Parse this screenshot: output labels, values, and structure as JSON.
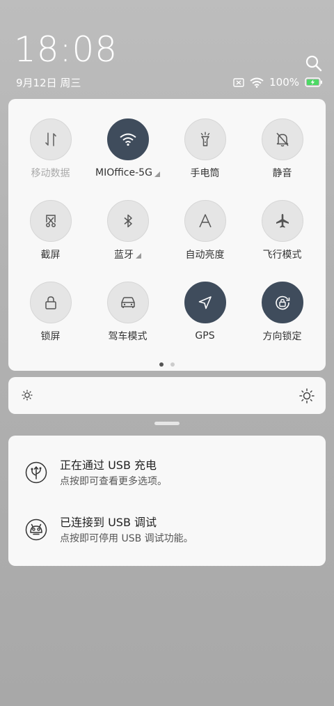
{
  "header": {
    "time": "18:08",
    "date": "9月12日 周三",
    "battery_percent": "100%",
    "icons": [
      "search-icon",
      "no-sim-icon",
      "wifi-icon",
      "battery-charging-icon"
    ]
  },
  "toggles": [
    {
      "label": "移动数据",
      "icon": "mobile-data-icon",
      "on": false,
      "dim": true,
      "expand": false
    },
    {
      "label": "MIOffice-5G",
      "icon": "wifi-icon",
      "on": true,
      "dim": false,
      "expand": true
    },
    {
      "label": "手电筒",
      "icon": "flashlight-icon",
      "on": false,
      "dim": false,
      "expand": false
    },
    {
      "label": "静音",
      "icon": "mute-bell-icon",
      "on": false,
      "dim": false,
      "expand": false
    },
    {
      "label": "截屏",
      "icon": "screenshot-icon",
      "on": false,
      "dim": false,
      "expand": false
    },
    {
      "label": "蓝牙",
      "icon": "bluetooth-icon",
      "on": false,
      "dim": false,
      "expand": true
    },
    {
      "label": "自动亮度",
      "icon": "auto-brightness-icon",
      "on": false,
      "dim": false,
      "expand": false
    },
    {
      "label": "飞行模式",
      "icon": "airplane-icon",
      "on": false,
      "dim": false,
      "expand": false
    },
    {
      "label": "锁屏",
      "icon": "lock-icon",
      "on": false,
      "dim": false,
      "expand": false
    },
    {
      "label": "驾车模式",
      "icon": "car-icon",
      "on": false,
      "dim": false,
      "expand": false
    },
    {
      "label": "GPS",
      "icon": "gps-icon",
      "on": true,
      "dim": false,
      "expand": false
    },
    {
      "label": "方向锁定",
      "icon": "rotation-lock-icon",
      "on": true,
      "dim": false,
      "expand": false
    }
  ],
  "pager": {
    "pages": 2,
    "active": 0
  },
  "brightness": {
    "icons": [
      "brightness-low-icon",
      "brightness-high-icon"
    ]
  },
  "notifications": [
    {
      "title": "正在通过 USB 充电",
      "subtitle": "点按即可查看更多选项。",
      "icon": "usb-icon"
    },
    {
      "title": "已连接到 USB 调试",
      "subtitle": "点按即可停用 USB 调试功能。",
      "icon": "android-debug-icon"
    }
  ],
  "colors": {
    "toggle_on": "#3f4c5c",
    "toggle_off": "#e5e5e5",
    "battery_green": "#4cd964"
  }
}
